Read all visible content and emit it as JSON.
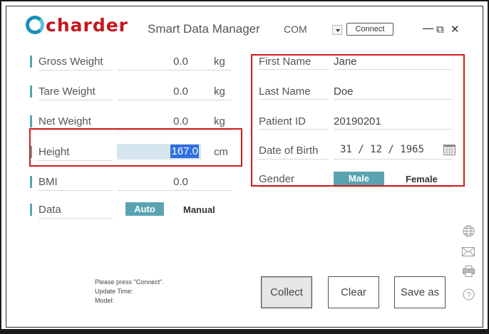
{
  "header": {
    "logo_text": "charder",
    "title": "Smart Data Manager",
    "com_label": "COM",
    "connect_label": "Connect",
    "minimize": "—",
    "restore": "⧉",
    "close": "✕"
  },
  "left_fields": [
    {
      "label": "Gross Weight",
      "value": "0.0",
      "unit": "kg"
    },
    {
      "label": "Tare Weight",
      "value": "0.0",
      "unit": "kg"
    },
    {
      "label": "Net Weight",
      "value": "0.0",
      "unit": "kg"
    },
    {
      "label": "Height",
      "value": "167.0",
      "unit": "cm"
    },
    {
      "label": "BMI",
      "value": "0.0",
      "unit": ""
    }
  ],
  "data_mode": {
    "label": "Data",
    "auto": "Auto",
    "manual": "Manual",
    "selected": "Auto"
  },
  "patient": {
    "first_name_label": "First Name",
    "first_name": "Jane",
    "last_name_label": "Last Name",
    "last_name": "Doe",
    "patient_id_label": "Patient ID",
    "patient_id": "20190201",
    "dob_label": "Date of Birth",
    "dob": "31 / 12 / 1965",
    "gender_label": "Gender",
    "male": "Male",
    "female": "Female",
    "gender_selected": "Male"
  },
  "status": {
    "line1": "Please press \"Connect\".",
    "line2": "Update Time:",
    "line3": "Model:"
  },
  "buttons": {
    "collect": "Collect",
    "clear": "Clear",
    "save_as": "Save as"
  },
  "side_icons": [
    "globe-icon",
    "mail-icon",
    "printer-icon",
    "help-icon"
  ],
  "colors": {
    "accent": "#5aa3b3",
    "highlight_box": "#d21a1a",
    "brand_red": "#c4161c",
    "brand_blue": "#1b8fb8"
  }
}
